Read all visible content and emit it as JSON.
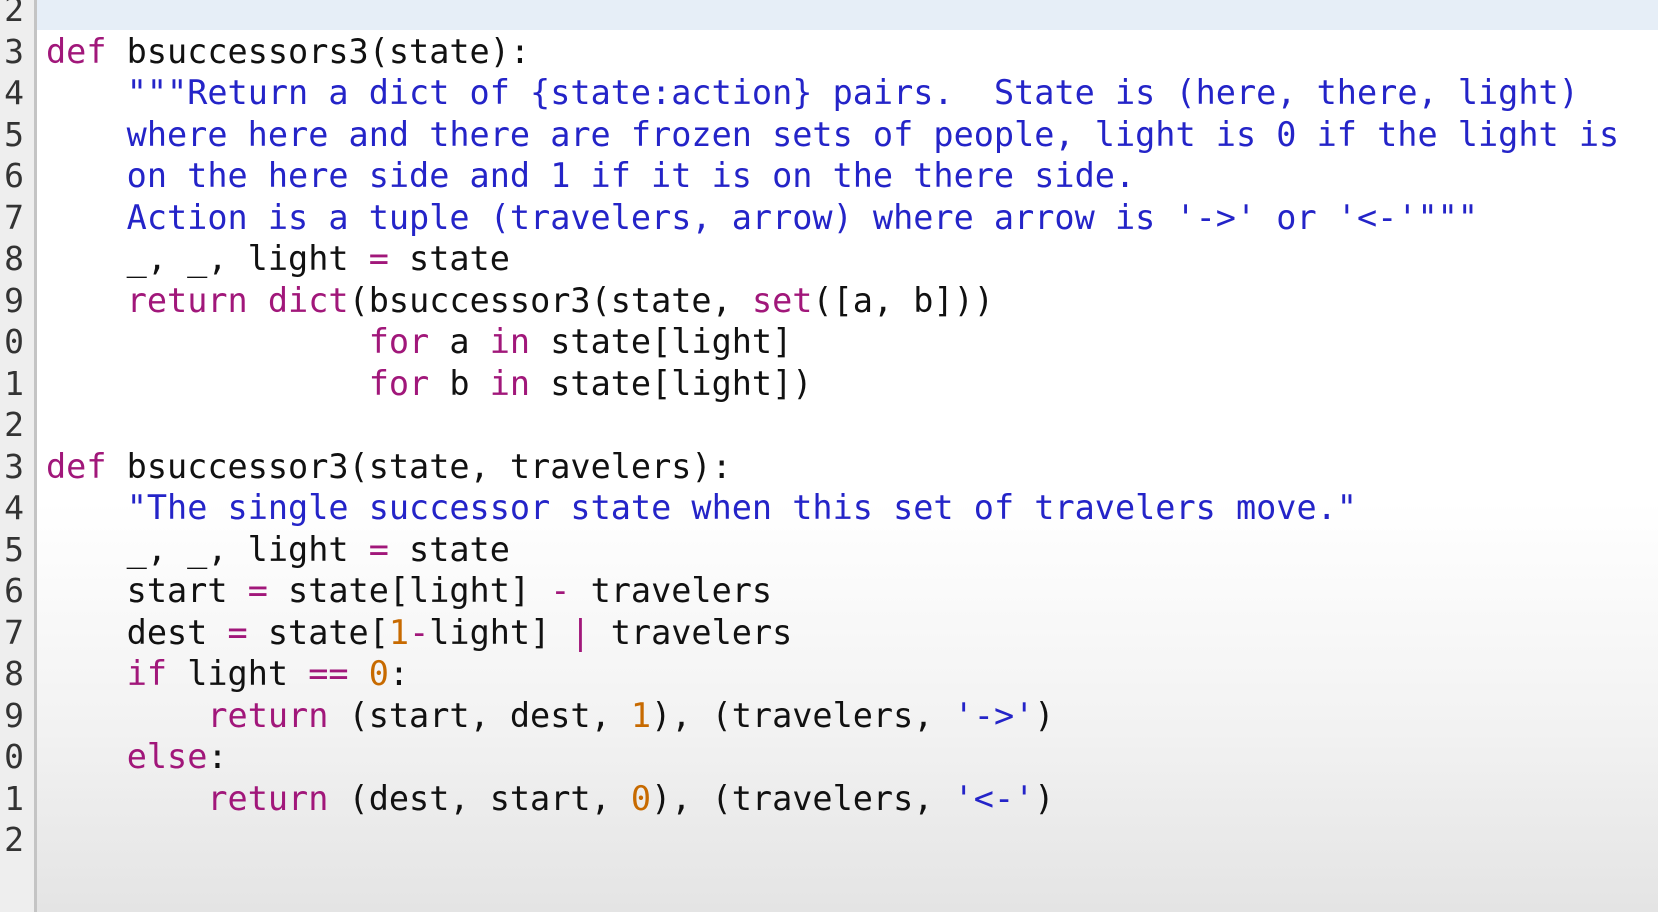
{
  "colors": {
    "keyword": "#a1177a",
    "string": "#2424c8",
    "number": "#c76a00",
    "operator": "#a1177a",
    "plain": "#111111",
    "gutter_background": "#eeeeee",
    "highlight_bar": "#e6eef7"
  },
  "gutter": {
    "line_numbers": [
      "2",
      "3",
      "4",
      "5",
      "6",
      "7",
      "8",
      "9",
      "0",
      "1",
      "2",
      "3",
      "4",
      "5",
      "6",
      "7",
      "8",
      "9",
      "0",
      "1",
      "2"
    ]
  },
  "code": {
    "lines": [
      [],
      [
        {
          "t": "kw",
          "v": "def"
        },
        {
          "t": "plain",
          "v": " bsuccessors3(state):"
        }
      ],
      [
        {
          "t": "plain",
          "v": "    "
        },
        {
          "t": "str",
          "v": "\"\"\"Return a dict of {state:action} pairs.  State is (here, there, light)"
        }
      ],
      [
        {
          "t": "str",
          "v": "    where here and there are frozen sets of people, light is 0 if the light is"
        }
      ],
      [
        {
          "t": "str",
          "v": "    on the here side and 1 if it is on the there side."
        }
      ],
      [
        {
          "t": "str",
          "v": "    Action is a tuple (travelers, arrow) where arrow is '->' or '<-'\"\"\""
        }
      ],
      [
        {
          "t": "plain",
          "v": "    _, _, light "
        },
        {
          "t": "op",
          "v": "="
        },
        {
          "t": "plain",
          "v": " state"
        }
      ],
      [
        {
          "t": "plain",
          "v": "    "
        },
        {
          "t": "kw",
          "v": "return"
        },
        {
          "t": "plain",
          "v": " "
        },
        {
          "t": "kw",
          "v": "dict"
        },
        {
          "t": "plain",
          "v": "(bsuccessor3(state, "
        },
        {
          "t": "kw",
          "v": "set"
        },
        {
          "t": "plain",
          "v": "([a, b]))"
        }
      ],
      [
        {
          "t": "plain",
          "v": "                "
        },
        {
          "t": "kw",
          "v": "for"
        },
        {
          "t": "plain",
          "v": " a "
        },
        {
          "t": "kw",
          "v": "in"
        },
        {
          "t": "plain",
          "v": " state[light]"
        }
      ],
      [
        {
          "t": "plain",
          "v": "                "
        },
        {
          "t": "kw",
          "v": "for"
        },
        {
          "t": "plain",
          "v": " b "
        },
        {
          "t": "kw",
          "v": "in"
        },
        {
          "t": "plain",
          "v": " state[light])"
        }
      ],
      [],
      [
        {
          "t": "kw",
          "v": "def"
        },
        {
          "t": "plain",
          "v": " bsuccessor3(state, travelers):"
        }
      ],
      [
        {
          "t": "plain",
          "v": "    "
        },
        {
          "t": "str",
          "v": "\"The single successor state when this set of travelers move.\""
        }
      ],
      [
        {
          "t": "plain",
          "v": "    _, _, light "
        },
        {
          "t": "op",
          "v": "="
        },
        {
          "t": "plain",
          "v": " state"
        }
      ],
      [
        {
          "t": "plain",
          "v": "    start "
        },
        {
          "t": "op",
          "v": "="
        },
        {
          "t": "plain",
          "v": " state[light] "
        },
        {
          "t": "op",
          "v": "-"
        },
        {
          "t": "plain",
          "v": " travelers"
        }
      ],
      [
        {
          "t": "plain",
          "v": "    dest "
        },
        {
          "t": "op",
          "v": "="
        },
        {
          "t": "plain",
          "v": " state["
        },
        {
          "t": "num",
          "v": "1"
        },
        {
          "t": "op",
          "v": "-"
        },
        {
          "t": "plain",
          "v": "light] "
        },
        {
          "t": "op",
          "v": "|"
        },
        {
          "t": "plain",
          "v": " travelers"
        }
      ],
      [
        {
          "t": "plain",
          "v": "    "
        },
        {
          "t": "kw",
          "v": "if"
        },
        {
          "t": "plain",
          "v": " light "
        },
        {
          "t": "op",
          "v": "=="
        },
        {
          "t": "plain",
          "v": " "
        },
        {
          "t": "num",
          "v": "0"
        },
        {
          "t": "plain",
          "v": ":"
        }
      ],
      [
        {
          "t": "plain",
          "v": "        "
        },
        {
          "t": "kw",
          "v": "return"
        },
        {
          "t": "plain",
          "v": " (start, dest, "
        },
        {
          "t": "num",
          "v": "1"
        },
        {
          "t": "plain",
          "v": "), (travelers, "
        },
        {
          "t": "str",
          "v": "'->'"
        },
        {
          "t": "plain",
          "v": ")"
        }
      ],
      [
        {
          "t": "plain",
          "v": "    "
        },
        {
          "t": "kw",
          "v": "else"
        },
        {
          "t": "plain",
          "v": ":"
        }
      ],
      [
        {
          "t": "plain",
          "v": "        "
        },
        {
          "t": "kw",
          "v": "return"
        },
        {
          "t": "plain",
          "v": " (dest, start, "
        },
        {
          "t": "num",
          "v": "0"
        },
        {
          "t": "plain",
          "v": "), (travelers, "
        },
        {
          "t": "str",
          "v": "'<-'"
        },
        {
          "t": "plain",
          "v": ")"
        }
      ],
      []
    ]
  }
}
